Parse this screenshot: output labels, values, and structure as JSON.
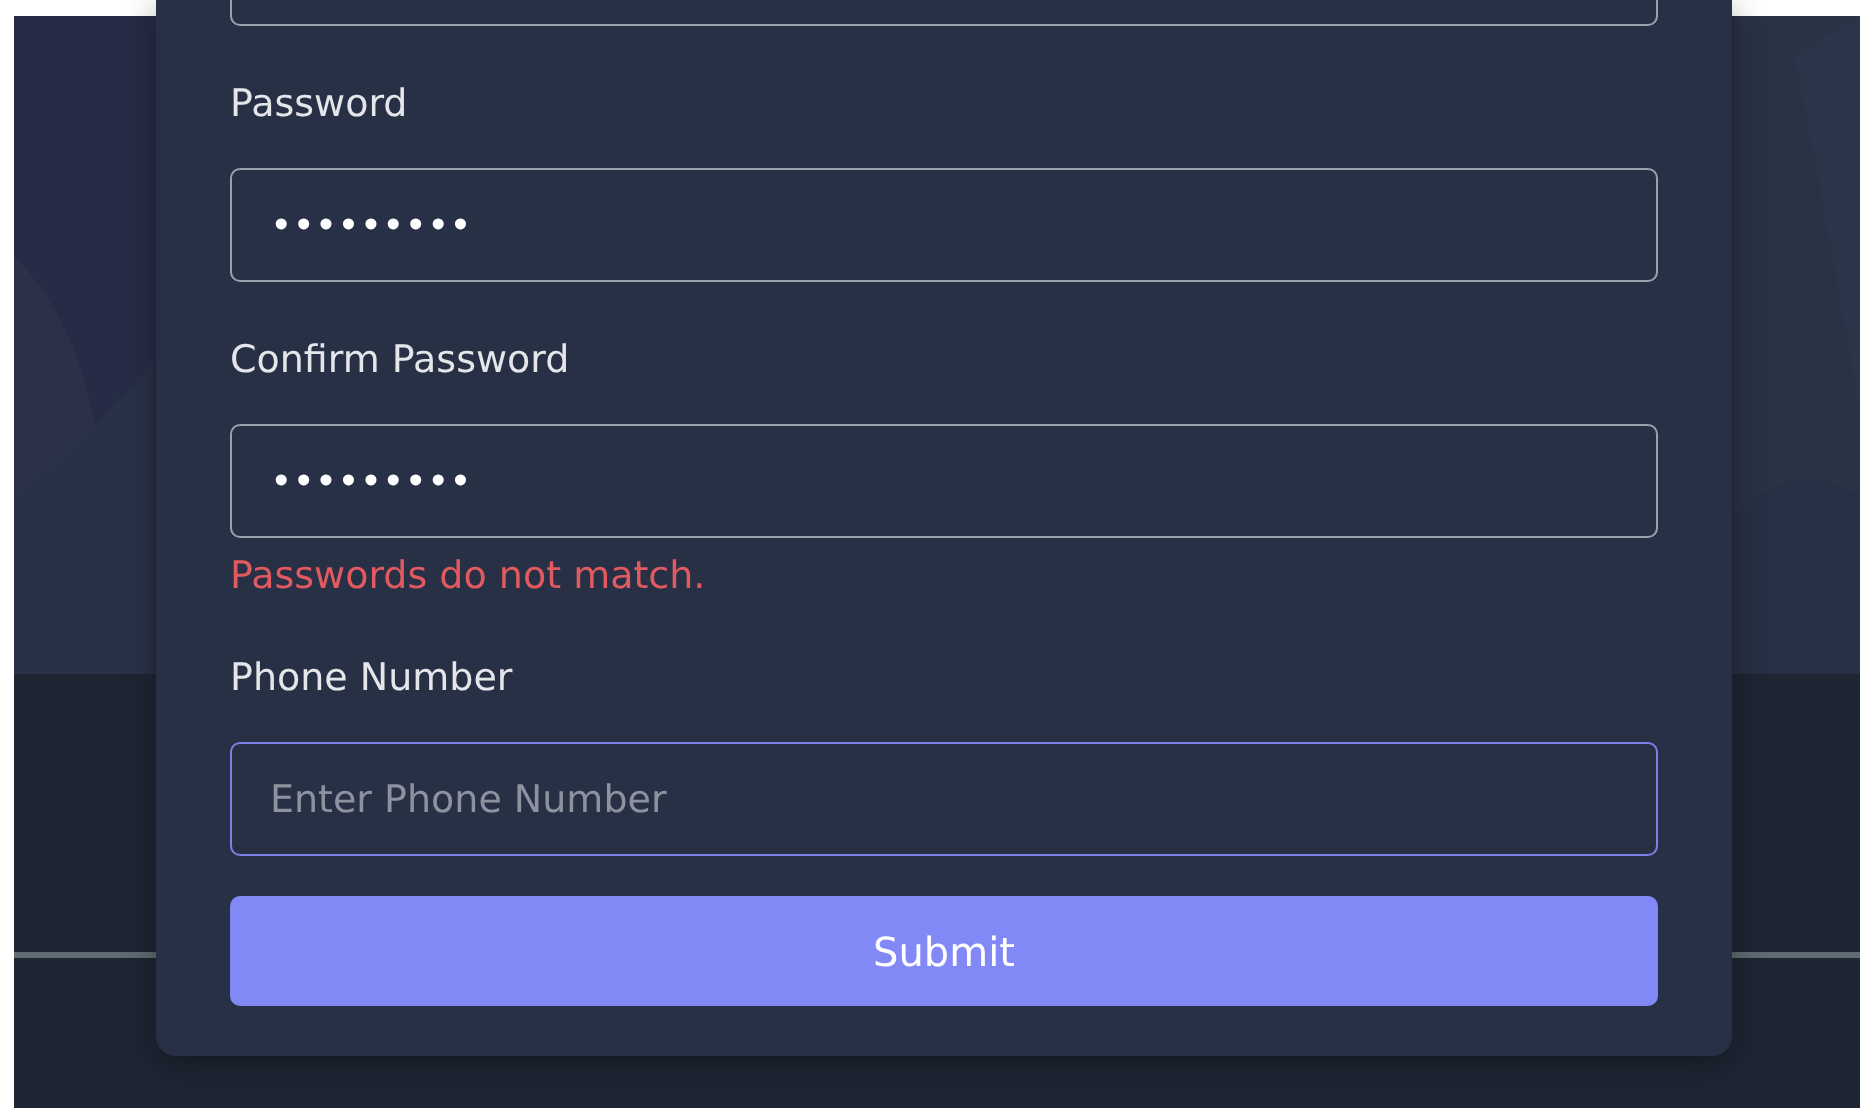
{
  "form": {
    "fields": [
      {
        "label": "Password",
        "value": "•••••••••",
        "focused": false
      },
      {
        "label": "Confirm Password",
        "value": "•••••••••",
        "focused": false,
        "error": "Passwords do not match."
      },
      {
        "label": "Phone Number",
        "placeholder": "Enter Phone Number",
        "focused": true
      }
    ],
    "submit": "Submit"
  }
}
